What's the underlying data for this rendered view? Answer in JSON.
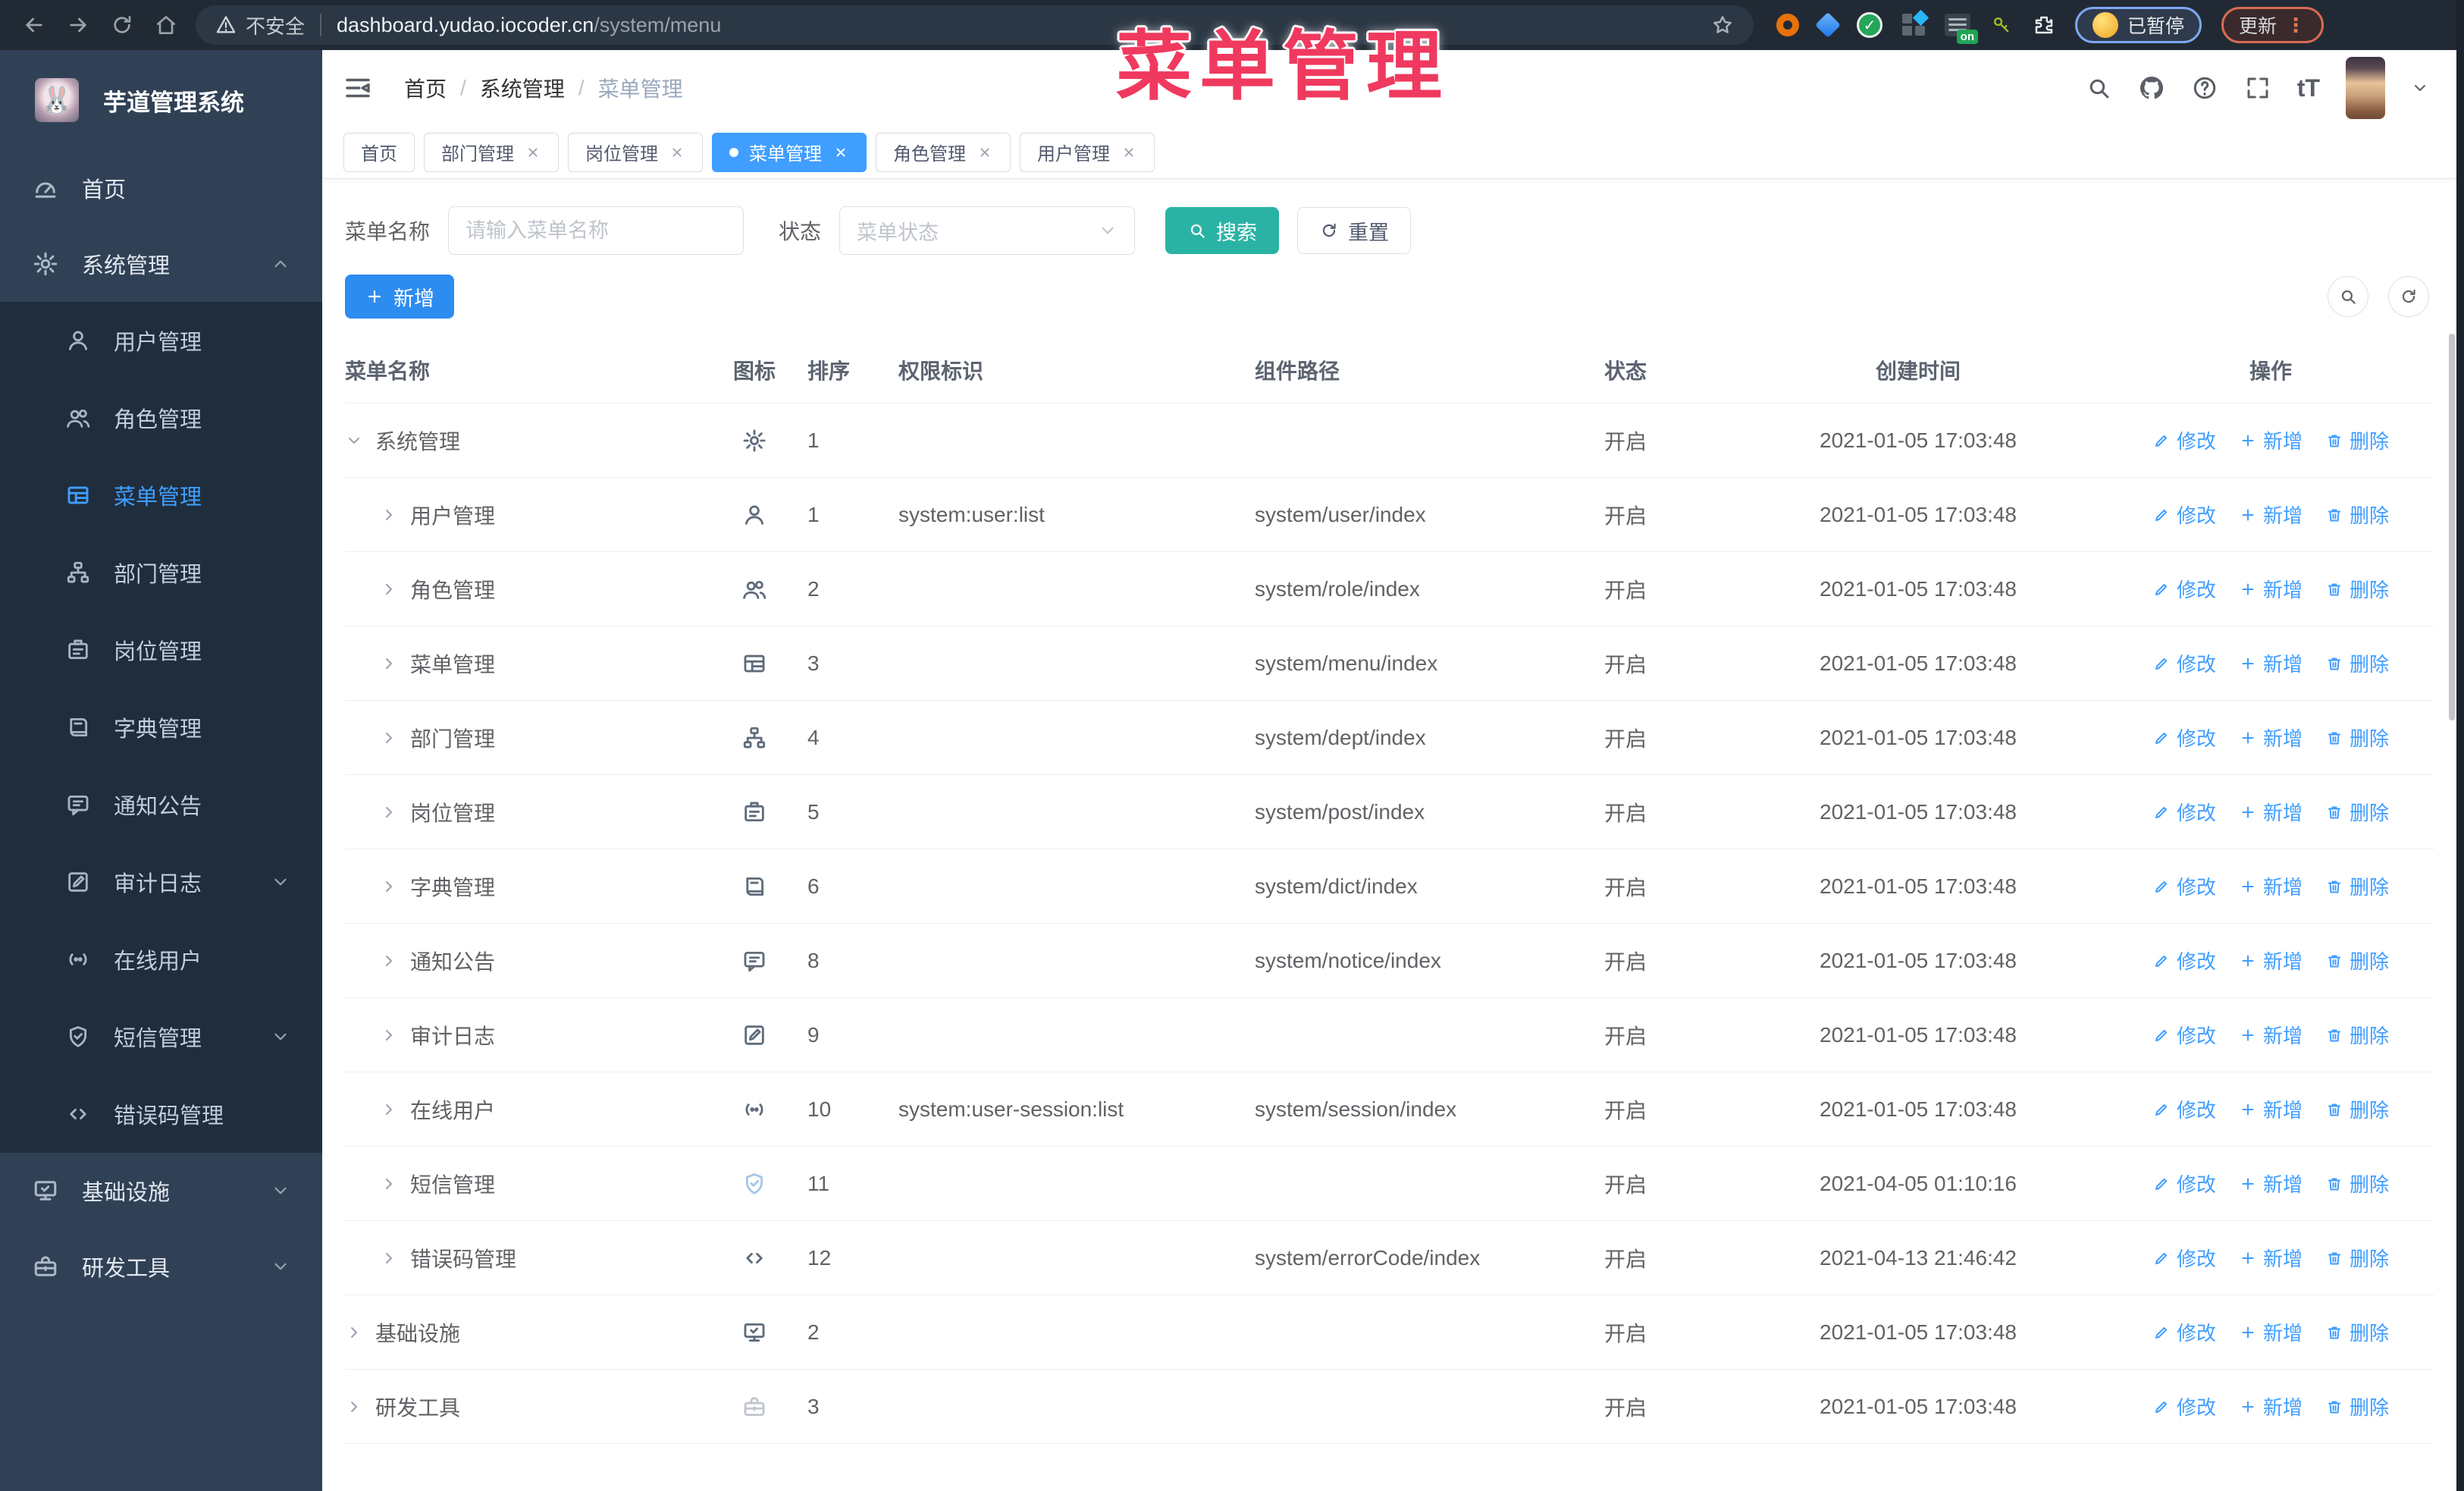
{
  "browser": {
    "security_label": "不安全",
    "url_host": "dashboard.yudao.iocoder.cn",
    "url_path": "/system/menu",
    "on_badge": "on",
    "paused_badge": "已暂停",
    "update_button": "更新"
  },
  "overlay": {
    "title": "菜单管理"
  },
  "sidebar": {
    "logo_title": "芋道管理系统",
    "logo_emoji": "🐰",
    "top": [
      {
        "icon": "dashboard",
        "label": "首页",
        "caret": ""
      },
      {
        "icon": "gear",
        "label": "系统管理",
        "caret": "up"
      }
    ],
    "submenu": [
      {
        "icon": "user",
        "label": "用户管理",
        "active": false,
        "caret": ""
      },
      {
        "icon": "users",
        "label": "角色管理",
        "active": false,
        "caret": ""
      },
      {
        "icon": "menu",
        "label": "菜单管理",
        "active": true,
        "caret": ""
      },
      {
        "icon": "tree",
        "label": "部门管理",
        "active": false,
        "caret": ""
      },
      {
        "icon": "badge",
        "label": "岗位管理",
        "active": false,
        "caret": ""
      },
      {
        "icon": "dict",
        "label": "字典管理",
        "active": false,
        "caret": ""
      },
      {
        "icon": "message",
        "label": "通知公告",
        "active": false,
        "caret": ""
      },
      {
        "icon": "log",
        "label": "审计日志",
        "active": false,
        "caret": "down"
      },
      {
        "icon": "online",
        "label": "在线用户",
        "active": false,
        "caret": ""
      },
      {
        "icon": "shield",
        "label": "短信管理",
        "active": false,
        "caret": "down"
      },
      {
        "icon": "code",
        "label": "错误码管理",
        "active": false,
        "caret": ""
      }
    ],
    "bottom": [
      {
        "icon": "monitor",
        "label": "基础设施",
        "caret": "down"
      },
      {
        "icon": "toolbox",
        "label": "研发工具",
        "caret": "down"
      }
    ]
  },
  "header": {
    "breadcrumb": [
      "首页",
      "系统管理",
      "菜单管理"
    ],
    "font_icon_text": "tT"
  },
  "tabs": [
    {
      "label": "首页",
      "closable": false,
      "active": false
    },
    {
      "label": "部门管理",
      "closable": true,
      "active": false
    },
    {
      "label": "岗位管理",
      "closable": true,
      "active": false
    },
    {
      "label": "菜单管理",
      "closable": true,
      "active": true
    },
    {
      "label": "角色管理",
      "closable": true,
      "active": false
    },
    {
      "label": "用户管理",
      "closable": true,
      "active": false
    }
  ],
  "filter": {
    "name_label": "菜单名称",
    "name_placeholder": "请输入菜单名称",
    "status_label": "状态",
    "status_placeholder": "菜单状态",
    "search_label": "搜索",
    "reset_label": "重置"
  },
  "toolbar": {
    "add_label": "新增"
  },
  "table": {
    "columns": [
      "菜单名称",
      "图标",
      "排序",
      "权限标识",
      "组件路径",
      "状态",
      "创建时间",
      "操作"
    ],
    "row_actions": [
      {
        "label": "修改",
        "icon": "pen"
      },
      {
        "label": "新增",
        "icon": "plus"
      },
      {
        "label": "删除",
        "icon": "trash"
      }
    ],
    "rows": [
      {
        "level": 0,
        "arrow": "down",
        "name": "系统管理",
        "icon": "gear",
        "icon_tone": "",
        "order": "1",
        "perm": "",
        "path": "",
        "status": "开启",
        "created": "2021-01-05 17:03:48"
      },
      {
        "level": 1,
        "arrow": "right",
        "name": "用户管理",
        "icon": "user",
        "icon_tone": "",
        "order": "1",
        "perm": "system:user:list",
        "path": "system/user/index",
        "status": "开启",
        "created": "2021-01-05 17:03:48"
      },
      {
        "level": 1,
        "arrow": "right",
        "name": "角色管理",
        "icon": "users",
        "icon_tone": "",
        "order": "2",
        "perm": "",
        "path": "system/role/index",
        "status": "开启",
        "created": "2021-01-05 17:03:48"
      },
      {
        "level": 1,
        "arrow": "right",
        "name": "菜单管理",
        "icon": "menu",
        "icon_tone": "",
        "order": "3",
        "perm": "",
        "path": "system/menu/index",
        "status": "开启",
        "created": "2021-01-05 17:03:48"
      },
      {
        "level": 1,
        "arrow": "right",
        "name": "部门管理",
        "icon": "tree",
        "icon_tone": "",
        "order": "4",
        "perm": "",
        "path": "system/dept/index",
        "status": "开启",
        "created": "2021-01-05 17:03:48"
      },
      {
        "level": 1,
        "arrow": "right",
        "name": "岗位管理",
        "icon": "badge",
        "icon_tone": "",
        "order": "5",
        "perm": "",
        "path": "system/post/index",
        "status": "开启",
        "created": "2021-01-05 17:03:48"
      },
      {
        "level": 1,
        "arrow": "right",
        "name": "字典管理",
        "icon": "dict",
        "icon_tone": "",
        "order": "6",
        "perm": "",
        "path": "system/dict/index",
        "status": "开启",
        "created": "2021-01-05 17:03:48"
      },
      {
        "level": 1,
        "arrow": "right",
        "name": "通知公告",
        "icon": "message",
        "icon_tone": "",
        "order": "8",
        "perm": "",
        "path": "system/notice/index",
        "status": "开启",
        "created": "2021-01-05 17:03:48"
      },
      {
        "level": 1,
        "arrow": "right",
        "name": "审计日志",
        "icon": "log",
        "icon_tone": "",
        "order": "9",
        "perm": "",
        "path": "",
        "status": "开启",
        "created": "2021-01-05 17:03:48"
      },
      {
        "level": 1,
        "arrow": "right",
        "name": "在线用户",
        "icon": "online",
        "icon_tone": "",
        "order": "10",
        "perm": "system:user-session:list",
        "path": "system/session/index",
        "status": "开启",
        "created": "2021-01-05 17:03:48"
      },
      {
        "level": 1,
        "arrow": "right",
        "name": "短信管理",
        "icon": "shield",
        "icon_tone": "muted-blue",
        "order": "11",
        "perm": "",
        "path": "",
        "status": "开启",
        "created": "2021-04-05 01:10:16"
      },
      {
        "level": 1,
        "arrow": "right",
        "name": "错误码管理",
        "icon": "code",
        "icon_tone": "",
        "order": "12",
        "perm": "",
        "path": "system/errorCode/index",
        "status": "开启",
        "created": "2021-04-13 21:46:42"
      },
      {
        "level": 0,
        "arrow": "right",
        "name": "基础设施",
        "icon": "monitor",
        "icon_tone": "",
        "order": "2",
        "perm": "",
        "path": "",
        "status": "开启",
        "created": "2021-01-05 17:03:48"
      },
      {
        "level": 0,
        "arrow": "right",
        "name": "研发工具",
        "icon": "toolbox",
        "icon_tone": "muted-gray",
        "order": "3",
        "perm": "",
        "path": "",
        "status": "开启",
        "created": "2021-01-05 17:03:48"
      }
    ]
  }
}
